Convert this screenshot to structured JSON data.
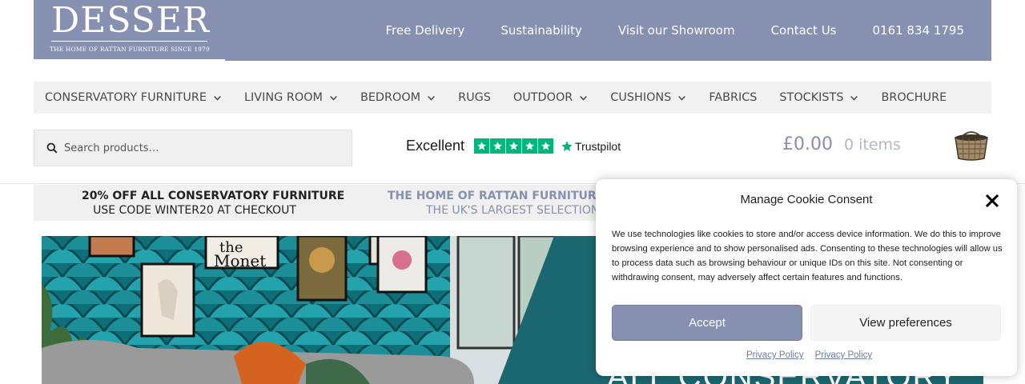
{
  "brand": {
    "name": "DESSER",
    "tagline": "THE HOME OF RATTAN FURNITURE SINCE 1979"
  },
  "top_links": [
    "Free Delivery",
    "Sustainability",
    "Visit our Showroom",
    "Contact Us",
    "0161 834 1795"
  ],
  "nav": [
    {
      "label": "CONSERVATORY FURNITURE",
      "has_dropdown": true
    },
    {
      "label": "LIVING ROOM",
      "has_dropdown": true
    },
    {
      "label": "BEDROOM",
      "has_dropdown": true
    },
    {
      "label": "RUGS",
      "has_dropdown": false
    },
    {
      "label": "OUTDOOR",
      "has_dropdown": true
    },
    {
      "label": "CUSHIONS",
      "has_dropdown": true
    },
    {
      "label": "FABRICS",
      "has_dropdown": false
    },
    {
      "label": "STOCKISTS",
      "has_dropdown": true
    },
    {
      "label": "BROCHURE",
      "has_dropdown": false
    }
  ],
  "search": {
    "placeholder": "Search products…",
    "value": "",
    "icon": "search-icon"
  },
  "trustpilot": {
    "label": "Excellent",
    "brand": "Trustpilot",
    "stars": 5
  },
  "cart": {
    "amount": "£0.00",
    "count": "0 items",
    "icon": "basket-icon"
  },
  "promo": [
    {
      "title": "20% OFF ALL CONSERVATORY FURNITURE",
      "subtitle": "USE CODE WINTER20 AT CHECKOUT"
    },
    {
      "title": "THE HOME OF RATTAN FURNITURE SINC",
      "subtitle": "THE UK'S LARGEST SELECTION"
    }
  ],
  "hero": {
    "text": "ALL CONSERVATORY",
    "art_label": "the Monet"
  },
  "cookie": {
    "title": "Manage Cookie Consent",
    "body": "We use technologies like cookies to store and/or access device information. We do this to improve browsing experience and to show personalised ads. Consenting to these technologies will allow us to process data such as browsing behaviour or unique IDs on this site. Not consenting or withdrawing consent, may adversely affect certain features and functions.",
    "accept": "Accept",
    "preferences": "View preferences",
    "links": [
      "Privacy Policy",
      "Privacy Policy"
    ]
  },
  "colors": {
    "brand": "#8690b0",
    "nav_bg": "#f2f2f2",
    "trustpilot_green": "#00b67a",
    "hero_teal": "#1d6a72"
  }
}
